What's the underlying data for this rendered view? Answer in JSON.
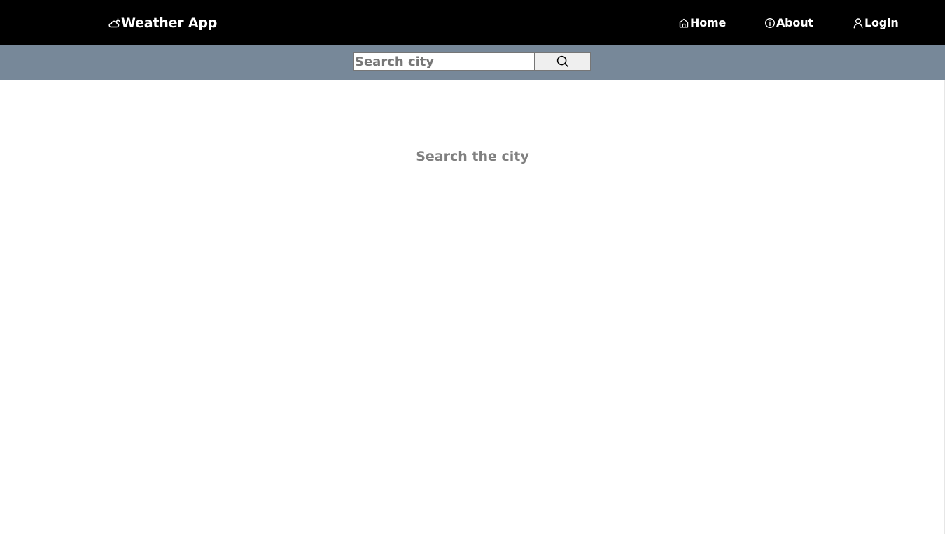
{
  "navbar": {
    "brand": {
      "icon": "cloud-sun-icon",
      "label": "Weather App"
    },
    "links": [
      {
        "icon": "home-icon",
        "label": "Home"
      },
      {
        "icon": "info-icon",
        "label": "About"
      },
      {
        "icon": "user-icon",
        "label": "Login"
      }
    ]
  },
  "search": {
    "placeholder": "Search city",
    "value": "",
    "button_icon": "search-icon"
  },
  "main": {
    "message": "Search the city"
  },
  "colors": {
    "navbar_bg": "#000000",
    "search_bar_bg": "#778899",
    "message_text": "#808080"
  }
}
